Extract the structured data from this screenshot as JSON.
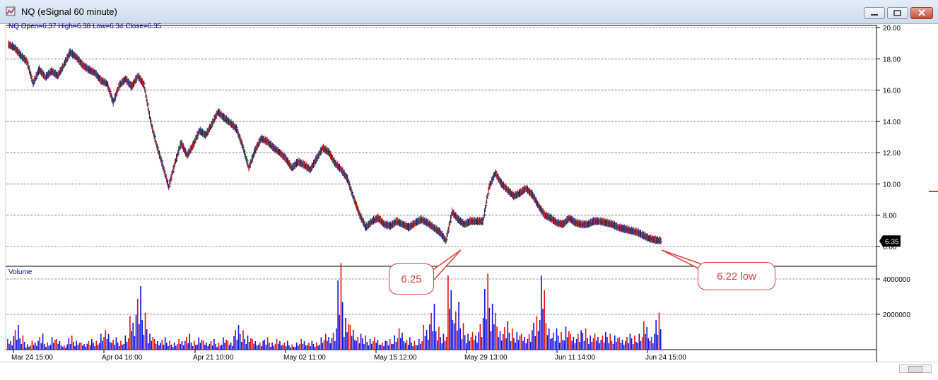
{
  "window": {
    "title": "NQ (eSignal 60 minute)"
  },
  "header": {
    "symbol": "NQ",
    "ohlc": "Open=6.37  High=6.38  Low=6.34  Close=6.35"
  },
  "volume_label": "Volume",
  "last_price_tag": "6.35",
  "callouts": [
    {
      "text": "6.25"
    },
    {
      "text": "6.22 low"
    }
  ],
  "colors": {
    "up_volume": "#1010e0",
    "down_volume": "#e01010",
    "callout": "#d9403a",
    "grid": "#000000"
  },
  "chart_data": {
    "type": "bar",
    "price_axis": {
      "min": 6,
      "max": 20,
      "ticks": [
        "20.00",
        "18.00",
        "16.00",
        "14.00",
        "12.00",
        "10.00",
        "8.00",
        "6.00"
      ]
    },
    "volume_axis": {
      "max": 5000000,
      "ticks": [
        "4000000",
        "2000000"
      ]
    },
    "x_tick_labels": [
      "Mar 24 15:00",
      "Apr 04 16:00",
      "Apr 21 10:00",
      "May 02 11:00",
      "May 15 12:00",
      "May 29 13:00",
      "Jun 11 14:00",
      "Jun 24 15:00"
    ],
    "price_path": [
      18.9,
      18.7,
      18.2,
      17.8,
      16.4,
      17.3,
      16.8,
      17.2,
      16.9,
      17.6,
      18.4,
      18.1,
      17.6,
      17.3,
      17.1,
      16.6,
      16.4,
      15.2,
      16.3,
      16.7,
      16.2,
      16.9,
      16.3,
      14.1,
      12.5,
      11.2,
      9.8,
      11.3,
      12.6,
      11.8,
      12.5,
      13.4,
      13.1,
      13.8,
      14.6,
      14.2,
      13.9,
      13.5,
      12.4,
      11.0,
      12.1,
      12.9,
      12.7,
      12.3,
      12.0,
      11.6,
      11.0,
      11.4,
      11.2,
      10.9,
      11.6,
      12.3,
      12.0,
      11.3,
      10.9,
      10.3,
      9.1,
      8.0,
      7.2,
      7.6,
      7.8,
      7.4,
      7.3,
      7.6,
      7.4,
      7.2,
      7.5,
      7.7,
      7.5,
      7.2,
      6.9,
      6.35,
      8.2,
      7.7,
      7.4,
      7.6,
      7.6,
      7.6,
      9.8,
      10.7,
      10.0,
      9.6,
      9.2,
      9.4,
      9.7,
      9.3,
      8.6,
      8.0,
      7.8,
      7.5,
      7.4,
      7.8,
      7.5,
      7.4,
      7.4,
      7.6,
      7.6,
      7.5,
      7.4,
      7.2,
      7.1,
      7.0,
      6.9,
      6.7,
      6.5,
      6.4,
      6.35
    ],
    "volume": [
      0.6,
      1.4,
      0.8,
      0.3,
      0.5,
      0.9,
      0.4,
      0.7,
      0.6,
      0.3,
      0.8,
      0.5,
      0.4,
      0.6,
      0.5,
      0.9,
      1.1,
      0.7,
      0.5,
      0.8,
      1.9,
      3.6,
      2.1,
      0.9,
      0.6,
      0.7,
      0.5,
      0.4,
      0.6,
      0.9,
      0.5,
      0.7,
      0.5,
      0.6,
      0.4,
      0.7,
      0.5,
      1.4,
      1.1,
      0.8,
      0.6,
      0.5,
      0.7,
      0.4,
      0.6,
      0.5,
      0.3,
      0.4,
      0.6,
      0.5,
      0.4,
      0.7,
      0.9,
      1.2,
      4.9,
      1.8,
      1.4,
      0.9,
      0.8,
      0.6,
      0.7,
      0.5,
      0.6,
      0.8,
      1.2,
      0.7,
      0.5,
      0.6,
      1.4,
      2.6,
      1.3,
      0.9,
      4.2,
      2.7,
      1.5,
      0.9,
      1.0,
      1.8,
      4.3,
      2.6,
      1.3,
      1.6,
      1.2,
      1.0,
      0.9,
      1.1,
      1.9,
      4.2,
      1.5,
      1.2,
      1.0,
      1.3,
      0.9,
      1.1,
      1.2,
      0.8,
      0.9,
      1.0,
      0.9,
      0.8,
      0.7,
      0.9,
      0.8,
      0.9,
      1.6,
      0.9,
      2.1
    ]
  }
}
